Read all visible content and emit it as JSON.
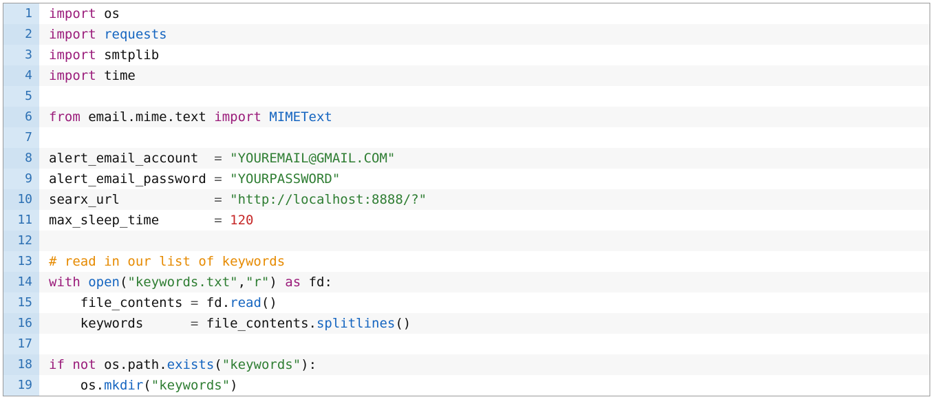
{
  "lines": [
    {
      "n": "1",
      "tokens": [
        {
          "t": "import ",
          "c": "tok-kw"
        },
        {
          "t": "os",
          "c": "tok-name"
        }
      ]
    },
    {
      "n": "2",
      "tokens": [
        {
          "t": "import ",
          "c": "tok-kw"
        },
        {
          "t": "requests",
          "c": "tok-mod"
        }
      ]
    },
    {
      "n": "3",
      "tokens": [
        {
          "t": "import ",
          "c": "tok-kw"
        },
        {
          "t": "smtplib",
          "c": "tok-name"
        }
      ]
    },
    {
      "n": "4",
      "tokens": [
        {
          "t": "import ",
          "c": "tok-kw"
        },
        {
          "t": "time",
          "c": "tok-name"
        }
      ]
    },
    {
      "n": "5",
      "tokens": [
        {
          "t": "",
          "c": "tok-name"
        }
      ]
    },
    {
      "n": "6",
      "tokens": [
        {
          "t": "from ",
          "c": "tok-kw"
        },
        {
          "t": "email",
          "c": "tok-name"
        },
        {
          "t": ".",
          "c": "tok-punc"
        },
        {
          "t": "mime",
          "c": "tok-name"
        },
        {
          "t": ".",
          "c": "tok-punc"
        },
        {
          "t": "text",
          "c": "tok-name"
        },
        {
          "t": " import ",
          "c": "tok-kw"
        },
        {
          "t": "MIMEText",
          "c": "tok-mod"
        }
      ]
    },
    {
      "n": "7",
      "tokens": [
        {
          "t": "",
          "c": "tok-name"
        }
      ]
    },
    {
      "n": "8",
      "tokens": [
        {
          "t": "alert_email_account  ",
          "c": "tok-name"
        },
        {
          "t": "=",
          "c": "tok-op"
        },
        {
          "t": " ",
          "c": "tok-name"
        },
        {
          "t": "\"YOUREMAIL@GMAIL.COM\"",
          "c": "tok-str"
        }
      ]
    },
    {
      "n": "9",
      "tokens": [
        {
          "t": "alert_email_password ",
          "c": "tok-name"
        },
        {
          "t": "=",
          "c": "tok-op"
        },
        {
          "t": " ",
          "c": "tok-name"
        },
        {
          "t": "\"YOURPASSWORD\"",
          "c": "tok-str"
        }
      ]
    },
    {
      "n": "10",
      "tokens": [
        {
          "t": "searx_url            ",
          "c": "tok-name"
        },
        {
          "t": "=",
          "c": "tok-op"
        },
        {
          "t": " ",
          "c": "tok-name"
        },
        {
          "t": "\"http://localhost:8888/?\"",
          "c": "tok-str"
        }
      ]
    },
    {
      "n": "11",
      "tokens": [
        {
          "t": "max_sleep_time       ",
          "c": "tok-name"
        },
        {
          "t": "=",
          "c": "tok-op"
        },
        {
          "t": " ",
          "c": "tok-name"
        },
        {
          "t": "120",
          "c": "tok-num"
        }
      ]
    },
    {
      "n": "12",
      "tokens": [
        {
          "t": "",
          "c": "tok-name"
        }
      ]
    },
    {
      "n": "13",
      "tokens": [
        {
          "t": "# read in our list of keywords",
          "c": "tok-cmt"
        }
      ]
    },
    {
      "n": "14",
      "tokens": [
        {
          "t": "with ",
          "c": "tok-kw"
        },
        {
          "t": "open",
          "c": "tok-func"
        },
        {
          "t": "(",
          "c": "tok-punc"
        },
        {
          "t": "\"keywords.txt\"",
          "c": "tok-str"
        },
        {
          "t": ",",
          "c": "tok-punc"
        },
        {
          "t": "\"r\"",
          "c": "tok-str"
        },
        {
          "t": ")",
          "c": "tok-punc"
        },
        {
          "t": " as ",
          "c": "tok-kw"
        },
        {
          "t": "fd",
          "c": "tok-name"
        },
        {
          "t": ":",
          "c": "tok-punc"
        }
      ]
    },
    {
      "n": "15",
      "tokens": [
        {
          "t": "    file_contents ",
          "c": "tok-name"
        },
        {
          "t": "=",
          "c": "tok-op"
        },
        {
          "t": " fd",
          "c": "tok-name"
        },
        {
          "t": ".",
          "c": "tok-punc"
        },
        {
          "t": "read",
          "c": "tok-func"
        },
        {
          "t": "()",
          "c": "tok-punc"
        }
      ]
    },
    {
      "n": "16",
      "tokens": [
        {
          "t": "    keywords      ",
          "c": "tok-name"
        },
        {
          "t": "=",
          "c": "tok-op"
        },
        {
          "t": " file_contents",
          "c": "tok-name"
        },
        {
          "t": ".",
          "c": "tok-punc"
        },
        {
          "t": "splitlines",
          "c": "tok-func"
        },
        {
          "t": "()",
          "c": "tok-punc"
        }
      ]
    },
    {
      "n": "17",
      "tokens": [
        {
          "t": "",
          "c": "tok-name"
        }
      ]
    },
    {
      "n": "18",
      "tokens": [
        {
          "t": "if ",
          "c": "tok-kw"
        },
        {
          "t": "not ",
          "c": "tok-kw"
        },
        {
          "t": "os",
          "c": "tok-name"
        },
        {
          "t": ".",
          "c": "tok-punc"
        },
        {
          "t": "path",
          "c": "tok-name"
        },
        {
          "t": ".",
          "c": "tok-punc"
        },
        {
          "t": "exists",
          "c": "tok-func"
        },
        {
          "t": "(",
          "c": "tok-punc"
        },
        {
          "t": "\"keywords\"",
          "c": "tok-str"
        },
        {
          "t": ")",
          "c": "tok-punc"
        },
        {
          "t": ":",
          "c": "tok-punc"
        }
      ]
    },
    {
      "n": "19",
      "tokens": [
        {
          "t": "    os",
          "c": "tok-name"
        },
        {
          "t": ".",
          "c": "tok-punc"
        },
        {
          "t": "mkdir",
          "c": "tok-func"
        },
        {
          "t": "(",
          "c": "tok-punc"
        },
        {
          "t": "\"keywords\"",
          "c": "tok-str"
        },
        {
          "t": ")",
          "c": "tok-punc"
        }
      ]
    }
  ]
}
